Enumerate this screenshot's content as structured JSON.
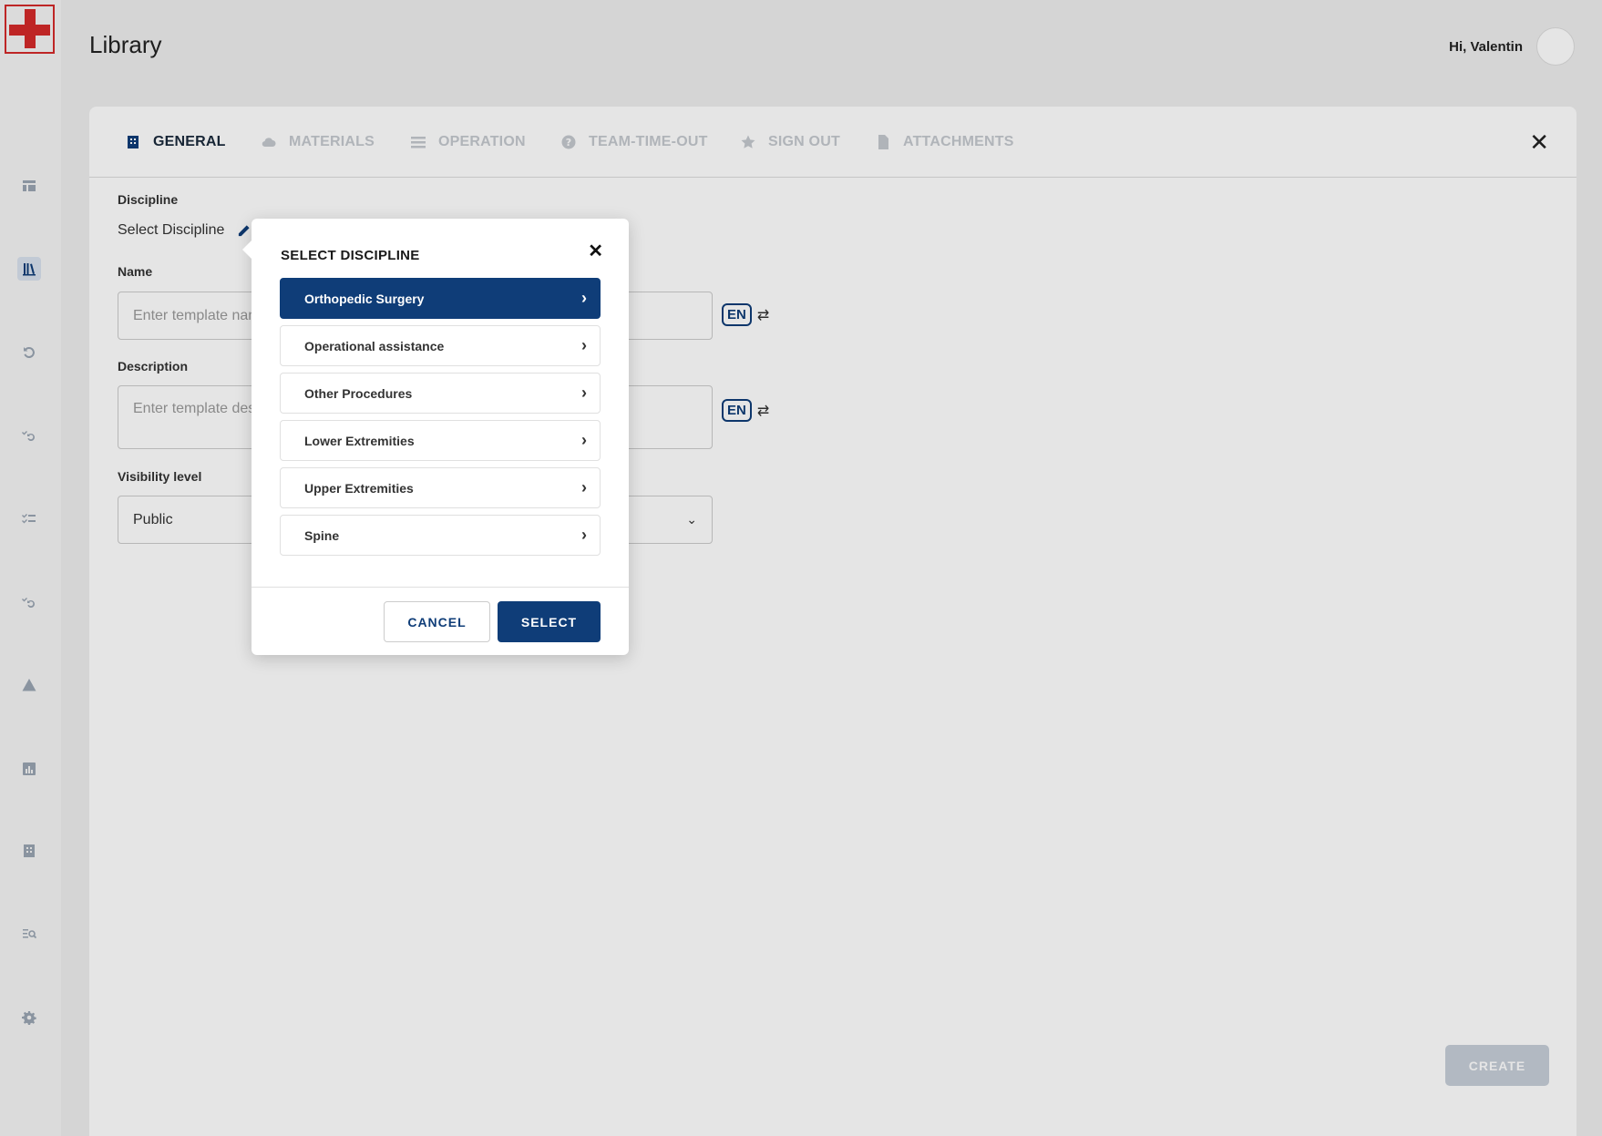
{
  "header": {
    "title": "Library",
    "greeting": "Hi, Valentin"
  },
  "sidebar": {
    "items": [
      {
        "name": "dashboard-icon"
      },
      {
        "name": "library-icon",
        "active": true
      },
      {
        "name": "history-icon"
      },
      {
        "name": "checklist-history-icon"
      },
      {
        "name": "checklist-icon"
      },
      {
        "name": "checklist-history-2-icon"
      },
      {
        "name": "warning-icon"
      },
      {
        "name": "chart-icon"
      },
      {
        "name": "building-icon"
      },
      {
        "name": "search-list-icon"
      },
      {
        "name": "gear-icon"
      }
    ]
  },
  "tabs": [
    {
      "label": "GENERAL",
      "icon": "building-icon",
      "active": true
    },
    {
      "label": "MATERIALS",
      "icon": "cloud-icon"
    },
    {
      "label": "OPERATION",
      "icon": "list-icon"
    },
    {
      "label": "TEAM-TIME-OUT",
      "icon": "question-icon"
    },
    {
      "label": "SIGN OUT",
      "icon": "star-icon"
    },
    {
      "label": "ATTACHMENTS",
      "icon": "file-icon"
    }
  ],
  "form": {
    "discipline_label": "Discipline",
    "discipline_value": "Select Discipline",
    "name_label": "Name",
    "name_placeholder": "Enter template nam",
    "description_label": "Description",
    "description_placeholder": "Enter template des",
    "visibility_label": "Visibility level",
    "visibility_value": "Public",
    "lang": "EN",
    "create_label": "CREATE"
  },
  "modal": {
    "title": "SELECT DISCIPLINE",
    "items": [
      {
        "label": "Orthopedic Surgery",
        "selected": true
      },
      {
        "label": "Operational assistance"
      },
      {
        "label": "Other Procedures"
      },
      {
        "label": "Lower Extremities"
      },
      {
        "label": "Upper Extremities"
      },
      {
        "label": "Spine"
      }
    ],
    "cancel_label": "CANCEL",
    "select_label": "SELECT"
  },
  "colors": {
    "primary": "#0f3d78",
    "brand_red": "#d42a2a"
  }
}
